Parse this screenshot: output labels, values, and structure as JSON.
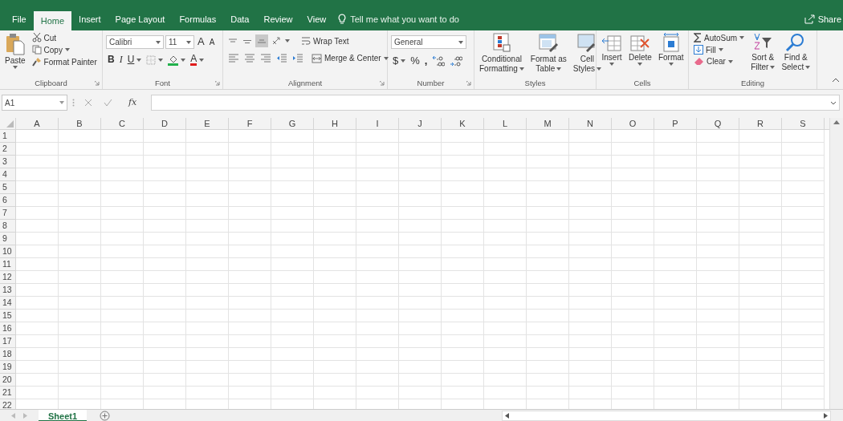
{
  "tabs": [
    {
      "label": "File",
      "selected": false
    },
    {
      "label": "Home",
      "selected": true
    },
    {
      "label": "Insert",
      "selected": false
    },
    {
      "label": "Page Layout",
      "selected": false
    },
    {
      "label": "Formulas",
      "selected": false
    },
    {
      "label": "Data",
      "selected": false
    },
    {
      "label": "Review",
      "selected": false
    },
    {
      "label": "View",
      "selected": false
    }
  ],
  "tell_me": {
    "placeholder": "Tell me what you want to do"
  },
  "share": {
    "label": "Share"
  },
  "ribbon": [
    {
      "kind": "clipboard",
      "label": "Clipboard",
      "paste": "Paste",
      "items": [
        "Cut",
        "Copy",
        "Format Painter"
      ]
    },
    {
      "kind": "font",
      "label": "Font",
      "font_name": "Calibri",
      "font_size": "11",
      "grow": "A",
      "shrink": "A",
      "styles": [
        {
          "kind": "bold",
          "label": "B"
        },
        {
          "kind": "italic",
          "label": "I"
        },
        {
          "kind": "underline",
          "label": "U"
        }
      ],
      "font_color": "A"
    },
    {
      "kind": "alignment",
      "label": "Alignment",
      "vertical": [
        {
          "selected": false
        },
        {
          "selected": false
        },
        {
          "selected": true
        }
      ],
      "wrap": "Wrap Text",
      "merge": "Merge & Center"
    },
    {
      "kind": "number",
      "label": "Number",
      "format": "General",
      "symbols": [
        "$",
        "%",
        ","
      ]
    },
    {
      "kind": "styles",
      "label": "Styles",
      "items": [
        [
          "Conditional",
          "Formatting"
        ],
        [
          "Format as",
          "Table"
        ],
        [
          "Cell",
          "Styles"
        ]
      ]
    },
    {
      "kind": "cells",
      "label": "Cells",
      "items": [
        "Insert",
        "Delete",
        "Format"
      ]
    },
    {
      "kind": "editing",
      "label": "Editing",
      "items": [
        "AutoSum",
        "Fill",
        "Clear"
      ],
      "big": [
        [
          "Sort &",
          "Filter"
        ],
        [
          "Find &",
          "Select"
        ]
      ]
    }
  ],
  "name_box": "A1",
  "fx": "fx",
  "columns": [
    "A",
    "B",
    "C",
    "D",
    "E",
    "F",
    "G",
    "H",
    "I",
    "J",
    "K",
    "L",
    "M",
    "N",
    "O",
    "P",
    "Q",
    "R",
    "S"
  ],
  "rows": [
    "1",
    "2",
    "3",
    "4",
    "5",
    "6",
    "7",
    "8",
    "9",
    "10",
    "11",
    "12",
    "13",
    "14",
    "15",
    "16",
    "17",
    "18",
    "19",
    "20",
    "21",
    "22"
  ],
  "sheets": [
    {
      "label": "Sheet1",
      "selected": true
    }
  ]
}
